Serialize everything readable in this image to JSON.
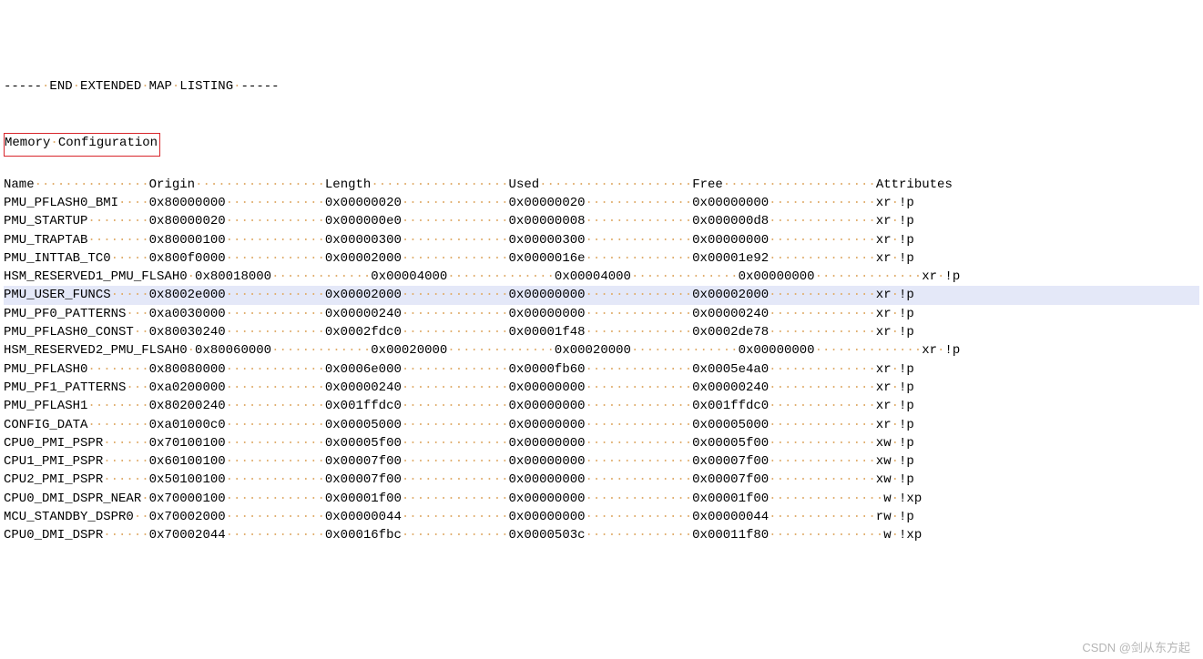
{
  "end_listing": "----- END EXTENDED MAP LISTING -----",
  "section_title": "Memory Configuration",
  "headers": {
    "name": "Name",
    "origin": "Origin",
    "length": "Length",
    "used": "Used",
    "free": "Free",
    "attributes": "Attributes"
  },
  "cols": {
    "name_w": 19,
    "origin_w": 23,
    "length_w": 24,
    "used_w": 24,
    "free_w": 24,
    "attr_w": 8
  },
  "rows": [
    {
      "name": "PMU_PFLASH0_BMI",
      "origin": "0x80000000",
      "length": "0x00000020",
      "used": "0x00000020",
      "free": "0x00000000",
      "attr": "xr !p",
      "shift": 0
    },
    {
      "name": "PMU_STARTUP",
      "origin": "0x80000020",
      "length": "0x000000e0",
      "used": "0x00000008",
      "free": "0x000000d8",
      "attr": "xr !p",
      "shift": 0
    },
    {
      "name": "PMU_TRAPTAB",
      "origin": "0x80000100",
      "length": "0x00000300",
      "used": "0x00000300",
      "free": "0x00000000",
      "attr": "xr !p",
      "shift": 0
    },
    {
      "name": "PMU_INTTAB_TC0",
      "origin": "0x800f0000",
      "length": "0x00002000",
      "used": "0x0000016e",
      "free": "0x00001e92",
      "attr": "xr !p",
      "shift": 0
    },
    {
      "name": "HSM_RESERVED1_PMU_FLSAH0",
      "origin": "0x80018000",
      "length": "0x00004000",
      "used": "0x00004000",
      "free": "0x00000000",
      "attr": "xr !p",
      "shift": 6
    },
    {
      "name": "PMU_USER_FUNCS",
      "origin": "0x8002e000",
      "length": "0x00002000",
      "used": "0x00000000",
      "free": "0x00002000",
      "attr": "xr !p",
      "shift": 0,
      "hl": true
    },
    {
      "name": "PMU_PF0_PATTERNS",
      "origin": "0xa0030000",
      "length": "0x00000240",
      "used": "0x00000000",
      "free": "0x00000240",
      "attr": "xr !p",
      "shift": 0
    },
    {
      "name": "PMU_PFLASH0_CONST",
      "origin": "0x80030240",
      "length": "0x0002fdc0",
      "used": "0x00001f48",
      "free": "0x0002de78",
      "attr": "xr !p",
      "shift": 0
    },
    {
      "name": "HSM_RESERVED2_PMU_FLSAH0",
      "origin": "0x80060000",
      "length": "0x00020000",
      "used": "0x00020000",
      "free": "0x00000000",
      "attr": "xr !p",
      "shift": 6
    },
    {
      "name": "PMU_PFLASH0",
      "origin": "0x80080000",
      "length": "0x0006e000",
      "used": "0x0000fb60",
      "free": "0x0005e4a0",
      "attr": "xr !p",
      "shift": 0
    },
    {
      "name": "PMU_PF1_PATTERNS",
      "origin": "0xa0200000",
      "length": "0x00000240",
      "used": "0x00000000",
      "free": "0x00000240",
      "attr": "xr !p",
      "shift": 0
    },
    {
      "name": "PMU_PFLASH1",
      "origin": "0x80200240",
      "length": "0x001ffdc0",
      "used": "0x00000000",
      "free": "0x001ffdc0",
      "attr": "xr !p",
      "shift": 0
    },
    {
      "name": "CONFIG_DATA",
      "origin": "0xa01000c0",
      "length": "0x00005000",
      "used": "0x00000000",
      "free": "0x00005000",
      "attr": "xr !p",
      "shift": 0
    },
    {
      "name": "CPU0_PMI_PSPR",
      "origin": "0x70100100",
      "length": "0x00005f00",
      "used": "0x00000000",
      "free": "0x00005f00",
      "attr": "xw !p",
      "shift": 0
    },
    {
      "name": "CPU1_PMI_PSPR",
      "origin": "0x60100100",
      "length": "0x00007f00",
      "used": "0x00000000",
      "free": "0x00007f00",
      "attr": "xw !p",
      "shift": 0
    },
    {
      "name": "CPU2_PMI_PSPR",
      "origin": "0x50100100",
      "length": "0x00007f00",
      "used": "0x00000000",
      "free": "0x00007f00",
      "attr": "xw !p",
      "shift": 0
    },
    {
      "name": "CPU0_DMI_DSPR_NEAR",
      "origin": "0x70000100",
      "length": "0x00001f00",
      "used": "0x00000000",
      "free": "0x00001f00",
      "attr": " w !xp",
      "shift": 0
    },
    {
      "name": "MCU_STANDBY_DSPR0",
      "origin": "0x70002000",
      "length": "0x00000044",
      "used": "0x00000000",
      "free": "0x00000044",
      "attr": "rw !p",
      "shift": 0
    },
    {
      "name": "CPU0_DMI_DSPR",
      "origin": "0x70002044",
      "length": "0x00016fbc",
      "used": "0x0000503c",
      "free": "0x00011f80",
      "attr": " w !xp",
      "shift": 0
    }
  ],
  "watermark": "CSDN @剑从东方起"
}
